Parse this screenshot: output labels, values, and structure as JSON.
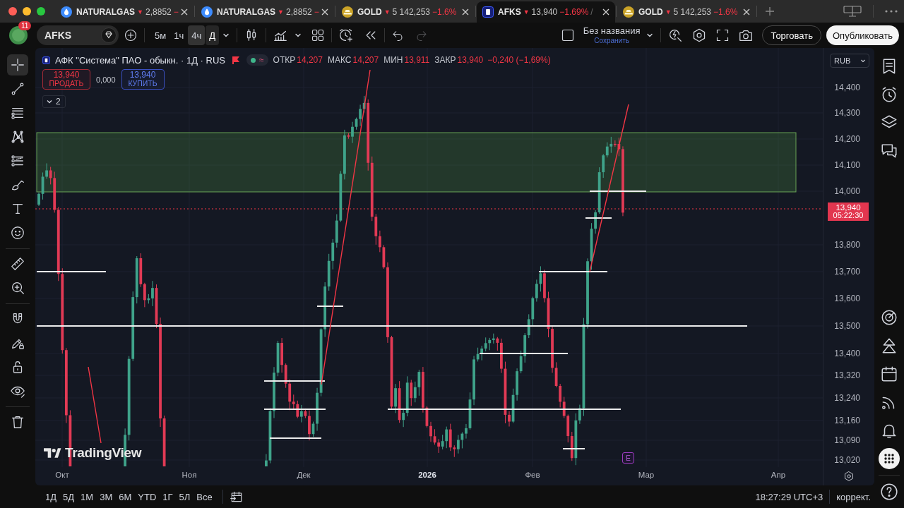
{
  "window": {
    "tabs": [
      {
        "kind": "gas",
        "symbol": "NATURALGAS",
        "arrow": "▼",
        "price": "2,8852",
        "change": "−",
        "selected": false
      },
      {
        "kind": "gas",
        "symbol": "NATURALGAS",
        "arrow": "▼",
        "price": "2,8852",
        "change": "−",
        "selected": false
      },
      {
        "kind": "metal",
        "symbol": "GOLD",
        "arrow": "▼",
        "price": "5 142,253",
        "change": "−1.6%",
        "selected": false
      },
      {
        "kind": "stock",
        "symbol": "AFKS",
        "arrow": "▼",
        "price": "13,940",
        "change": "−1.69%",
        "suffix": "/",
        "selected": true
      },
      {
        "kind": "metal",
        "symbol": "GOLD",
        "arrow": "▼",
        "price": "5 142,253",
        "change": "−1.6%",
        "selected": false
      }
    ]
  },
  "toolbar": {
    "avatar_badge": "11",
    "symbol": "AFKS",
    "intervals": [
      {
        "label": "5м",
        "selected": false,
        "hovered": false
      },
      {
        "label": "1ч",
        "selected": false,
        "hovered": false
      },
      {
        "label": "4ч",
        "selected": false,
        "hovered": true
      },
      {
        "label": "Д",
        "selected": true,
        "hovered": false
      }
    ],
    "redo_disabled": true,
    "layout_name": "Без названия",
    "save_link": "Сохранить",
    "buttons": [
      {
        "label": "Торговать",
        "kind": "secondary"
      },
      {
        "label": "Опубликовать",
        "kind": "primary"
      }
    ]
  },
  "left_toolbar": {
    "groups": [
      {
        "tools": [
          {
            "selected": true
          },
          {
            "selected": false
          },
          {
            "selected": false
          },
          {
            "selected": false
          },
          {
            "selected": false
          },
          {
            "selected": false
          },
          {
            "selected": false
          },
          {
            "selected": false
          }
        ]
      },
      {
        "tools": [
          {
            "selected": false
          },
          {
            "selected": false
          }
        ]
      },
      {
        "tools": [
          {
            "selected": false
          },
          {
            "selected": false
          },
          {
            "selected": false
          },
          {
            "selected": false
          }
        ]
      },
      {
        "tools": [
          {
            "selected": false
          }
        ]
      }
    ]
  },
  "chart": {
    "title": "АФК \"Система\" ПАО - обыкн. · 1Д · RUS",
    "status": "≈",
    "ohlc": [
      {
        "label": "ОТКР",
        "value": "14,207"
      },
      {
        "label": "МАКС",
        "value": "14,207"
      },
      {
        "label": "МИН",
        "value": "13,911"
      },
      {
        "label": "ЗАКР",
        "value": "13,940"
      }
    ],
    "change": "−0,240 (−1,69%)",
    "sell": {
      "price": "13,940",
      "label": "ПРОДАТЬ"
    },
    "spread": "0,000",
    "buy": {
      "price": "13,940",
      "label": "КУПИТЬ"
    },
    "collapsed_count": "2",
    "event_marker": "E",
    "logo": "TradingView"
  },
  "price_axis": {
    "currency": "RUB",
    "labels": [
      "14,400",
      "14,300",
      "14,200",
      "14,100",
      "14,000",
      "13,800",
      "13,700",
      "13,600",
      "13,500",
      "13,400",
      "13,320",
      "13,240",
      "13,160",
      "13,090",
      "13,020"
    ],
    "last_price": "13,940",
    "countdown": "05:22:30"
  },
  "time_axis": {
    "labels": [
      {
        "text": "Окт",
        "kind": "month"
      },
      {
        "text": "Ноя",
        "kind": "month"
      },
      {
        "text": "Дек",
        "kind": "month"
      },
      {
        "text": "2026",
        "kind": "year"
      },
      {
        "text": "Фев",
        "kind": "month"
      },
      {
        "text": "Мар",
        "kind": "month"
      },
      {
        "text": "Апр",
        "kind": "month"
      }
    ]
  },
  "bottom_bar": {
    "ranges": [
      "1Д",
      "5Д",
      "1М",
      "3М",
      "6М",
      "YTD",
      "1Г",
      "5Л",
      "Все"
    ],
    "clock": "18:27:29 UTC+3",
    "adjust": "коррект."
  }
}
